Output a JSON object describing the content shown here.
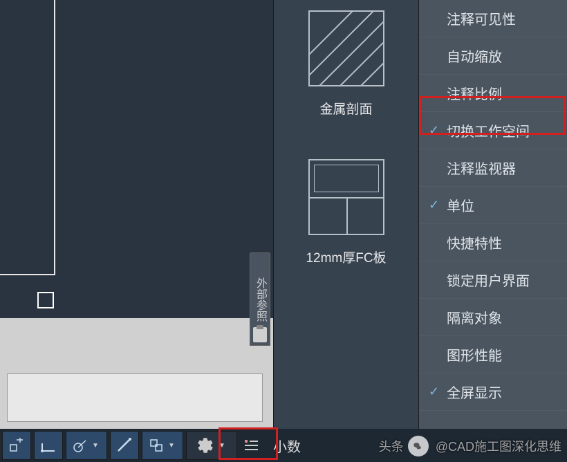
{
  "palette": {
    "pattern1_label": "金属剖面",
    "pattern2_label": "12mm厚FC板"
  },
  "side_tab": {
    "label": "外部参照"
  },
  "menu": {
    "items": [
      {
        "label": "注释可见性",
        "checked": false
      },
      {
        "label": "自动缩放",
        "checked": false
      },
      {
        "label": "注释比例",
        "checked": false
      },
      {
        "label": "切换工作空间",
        "checked": true
      },
      {
        "label": "注释监视器",
        "checked": false
      },
      {
        "label": "单位",
        "checked": true
      },
      {
        "label": "快捷特性",
        "checked": false
      },
      {
        "label": "锁定用户界面",
        "checked": false
      },
      {
        "label": "隔离对象",
        "checked": false
      },
      {
        "label": "图形性能",
        "checked": false
      },
      {
        "label": "全屏显示",
        "checked": true
      }
    ]
  },
  "statusbar": {
    "units_label": "小数"
  },
  "watermark": {
    "prefix": "头条",
    "text": "@CAD施工图深化思维"
  }
}
